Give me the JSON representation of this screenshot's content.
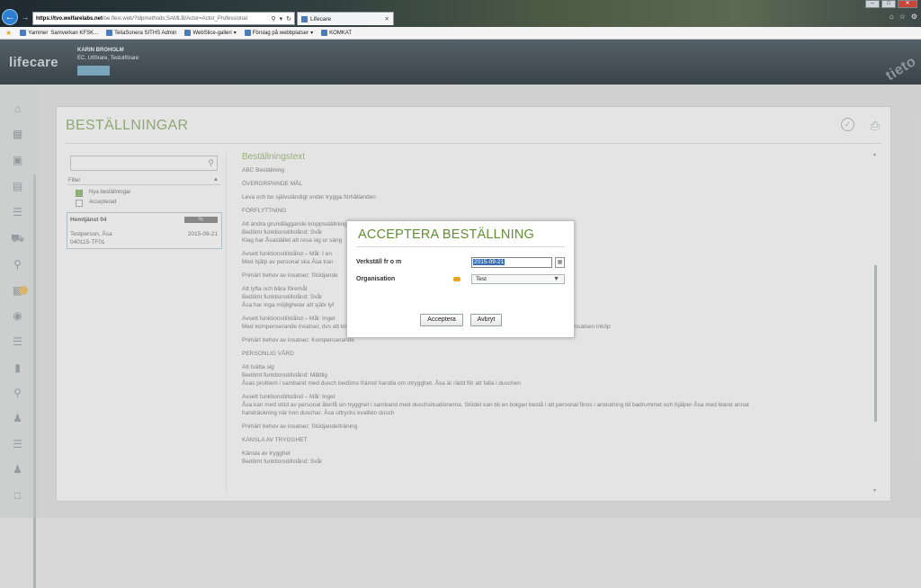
{
  "browser": {
    "url_host": "https://tvo.welfarelabs.net",
    "url_rest": "/oe.flexi.web/?ldpmethods;SAMLB/Actor=Actor_Professional",
    "tab_title": "Lifecare"
  },
  "favorites": [
    "Yammer",
    "Samverkan KFSK...",
    "TeliaSonera SITHS Admin",
    "WebSlice-galleri",
    "Förslag på webbplatser",
    "KOMKAT"
  ],
  "app": {
    "logo": "lifecare",
    "user_name": "KARIN BROHOLM",
    "user_role": "EC, Utförare, Testutförare",
    "tieto_logo": "tieto"
  },
  "page": {
    "title": "BESTÄLLNINGAR",
    "filter_label": "Filter",
    "filters": [
      {
        "label": "Nya beställningar",
        "checked": true
      },
      {
        "label": "Accepterad",
        "checked": false
      }
    ],
    "order": {
      "title": "Hemtjänst 04",
      "badge": "Ny",
      "name": "Testperson, Åsa",
      "date": "2015-09-21",
      "code": "040115-TF01"
    },
    "content_heading": "Beställningstext",
    "content_lines": [
      "ABC Beställning",
      "",
      "ÖVERGRIPANDE MÅL",
      "",
      "Leva och bo självständigt under trygga förhållanden",
      "",
      "FÖRFLYTTNING",
      "",
      "Att ändra grundläggande kroppsställning",
      "Bedömt funktionstillstånd: Svår",
      "Klag har Åsastället att resa sig ur säng",
      "",
      "Avsett funktionstillstånd – Mål: I en",
      "Med hjälp av personal ska Åsa tran",
      "",
      "Primärt behov av insatser: Stödjande",
      "",
      "Att lyfta och bära föremål",
      "Bedömt funktionstillstånd: Svår",
      "Åsa har inga möjligheter att själv lyf",
      "",
      "Avsett funktionstillstånd – Mål: Inget",
      "Med kompenserande insatser, dvs att kliva på Åsa får hjälp av personal att hantera saker. Via att bära hem mat. Detta tyvs orsa insatsen inköp",
      "",
      "Primärt behov av insatser: Kompenserande",
      "",
      "PERSONLIG VÅRD",
      "",
      "Att tvätta sig",
      "Bedömt funktionstillstånd: Måttlig",
      "Åsas problem i samband med dusch bedöms främst handla om otrygghet. Åsa är rädd för att falla i duschen",
      "",
      "Avsett funktionstillstånd – Mål: Inget",
      "Åsa kan med stöd av personal återfå sin trygghet i samband med duschsituationerna. Stödet kan bli en bolgan bestå i att personal finns i anslutning till badrummet och hjälper Åsa med bland annat",
      "handräckning när hon duschar. Åsa uttrycks kvalitén dusch",
      "",
      "Primärt behov av insatser: Stödjande/träning",
      "",
      "KÄNSLA AV TRYGGHET",
      "",
      "Känsla av trygghet",
      "Bedömt funktionstillstånd: Svår"
    ]
  },
  "modal": {
    "title": "ACCEPTERA BESTÄLLNING",
    "date_label": "Verkställ fr o m",
    "date_value": "2015-09-21",
    "org_label": "Organisation",
    "org_value": "Test",
    "accept_label": "Acceptera",
    "cancel_label": "Avbryt"
  },
  "colors": {
    "accent_green": "#5f8f2e",
    "required_orange": "#e8a521",
    "header_dark": "#39434a"
  }
}
